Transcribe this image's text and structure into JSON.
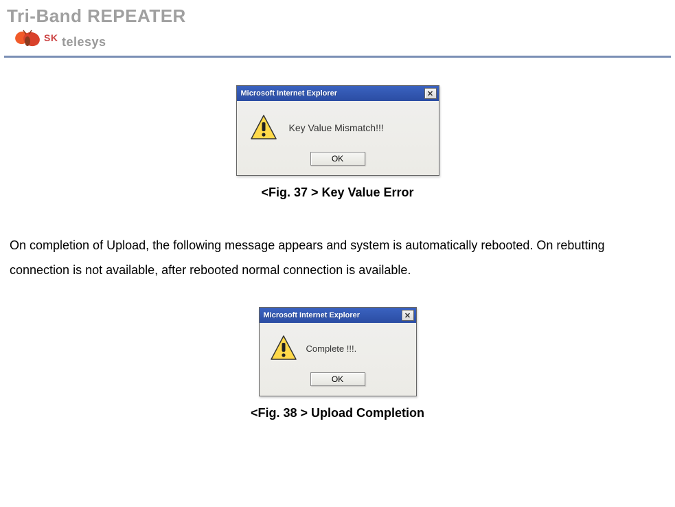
{
  "header": {
    "title": "Tri-Band REPEATER",
    "logo_text": "telesys",
    "logo_prefix": "SK"
  },
  "dialog1": {
    "title": "Microsoft Internet Explorer",
    "message": "Key Value Mismatch!!!",
    "ok_label": "OK",
    "close_glyph": "✕"
  },
  "caption1": "<Fig. 37 > Key Value Error",
  "paragraph": "On completion of Upload, the following message appears and system is automatically rebooted. On rebutting connection is not available, after rebooted normal connection is available.",
  "dialog2": {
    "title": "Microsoft Internet Explorer",
    "message": "Complete !!!.",
    "ok_label": "OK",
    "close_glyph": "✕"
  },
  "caption2": "<Fig. 38 > Upload Completion"
}
